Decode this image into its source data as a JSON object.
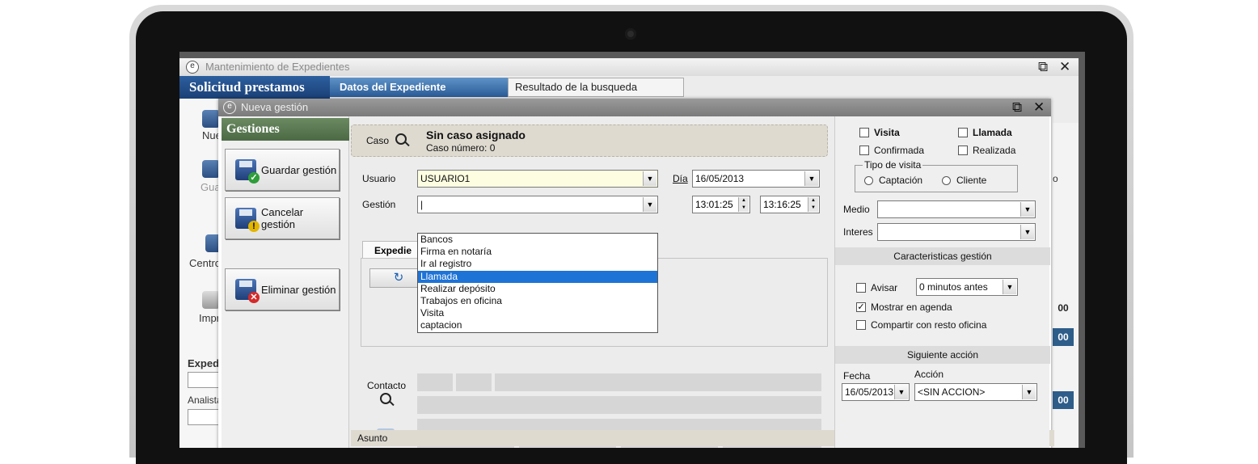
{
  "back_window": {
    "title": "Mantenimiento de Expedientes",
    "header": "Solicitud prestamos",
    "tabs": [
      "Datos del Expediente",
      "Resultado de la busqueda"
    ],
    "side_fragments": [
      "Nue",
      "Gua",
      "Centro",
      "Impr",
      "Expedi",
      "Analista"
    ],
    "right_fragments": [
      "o",
      "00",
      "00",
      "00"
    ]
  },
  "dialog": {
    "title": "Nueva gestión",
    "left_header": "Gestiones",
    "buttons": {
      "save": "Guardar gestión",
      "cancel": "Cancelar gestión",
      "delete": "Eliminar gestión"
    },
    "caso": {
      "label": "Caso",
      "title": "Sin caso asignado",
      "number": "Caso número:  0"
    },
    "usuario": {
      "label": "Usuario",
      "value": "USUARIO1"
    },
    "gestion": {
      "label": "Gestión",
      "value": "",
      "options": [
        "Bancos",
        "Firma en notaría",
        "Ir al registro",
        "Llamada",
        "Realizar depósito",
        "Trabajos en oficina",
        "Visita",
        "captacion"
      ],
      "highlighted": "Llamada"
    },
    "dia": {
      "label": "Día",
      "value": "16/05/2013"
    },
    "time_start": "13:01:25",
    "time_end": "13:16:25",
    "expediente_tab": "Expedie",
    "contacto_label": "Contacto",
    "asunto_label": "Asunto",
    "right": {
      "visita": "Visita",
      "llamada": "Llamada",
      "confirmada": "Confirmada",
      "realizada": "Realizada",
      "tipo_visita": "Tipo de visita",
      "captacion": "Captación",
      "cliente": "Cliente",
      "medio_label": "Medio",
      "interes_label": "Interes",
      "caracteristicas": "Caracteristicas gestión",
      "avisar": "Avisar",
      "minutos": "0 minutos antes",
      "mostrar_agenda": "Mostrar en agenda",
      "compartir": "Compartir con resto oficina",
      "siguiente": "Siguiente acción",
      "fecha_label": "Fecha",
      "accion_label": "Acción",
      "fecha_value": "16/05/2013",
      "accion_value": "<SIN ACCION>"
    }
  },
  "colors": {
    "header_blue": "#1a3f75",
    "gestiones_green": "#4b6a44",
    "selection": "#1e73d6",
    "caso_bg": "#dedad0"
  }
}
